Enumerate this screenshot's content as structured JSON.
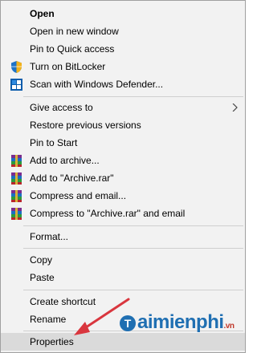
{
  "menu": {
    "groups": [
      [
        {
          "label": "Open",
          "bold": true,
          "icon": null
        },
        {
          "label": "Open in new window",
          "icon": null
        },
        {
          "label": "Pin to Quick access",
          "icon": null
        },
        {
          "label": "Turn on BitLocker",
          "icon": "shield-icon"
        },
        {
          "label": "Scan with Windows Defender...",
          "icon": "defender-icon"
        }
      ],
      [
        {
          "label": "Give access to",
          "icon": null,
          "submenu": true
        },
        {
          "label": "Restore previous versions",
          "icon": null
        },
        {
          "label": "Pin to Start",
          "icon": null
        },
        {
          "label": "Add to archive...",
          "icon": "winrar-icon"
        },
        {
          "label": "Add to \"Archive.rar\"",
          "icon": "winrar-icon"
        },
        {
          "label": "Compress and email...",
          "icon": "winrar-icon"
        },
        {
          "label": "Compress to \"Archive.rar\" and email",
          "icon": "winrar-icon"
        }
      ],
      [
        {
          "label": "Format...",
          "icon": null
        }
      ],
      [
        {
          "label": "Copy",
          "icon": null
        },
        {
          "label": "Paste",
          "icon": null
        }
      ],
      [
        {
          "label": "Create shortcut",
          "icon": null
        },
        {
          "label": "Rename",
          "icon": null
        }
      ],
      [
        {
          "label": "Properties",
          "icon": null,
          "highlighted": true
        }
      ]
    ]
  },
  "watermark": {
    "brand": "aimienphi",
    "suffix": ".vn",
    "logo_letter": "T"
  },
  "colors": {
    "menu_bg": "#f2f2f2",
    "highlight_bg": "#dadada",
    "separator": "#cfcfcf",
    "annotation_arrow": "#d9363e",
    "watermark_blue": "#1f6fb2"
  }
}
